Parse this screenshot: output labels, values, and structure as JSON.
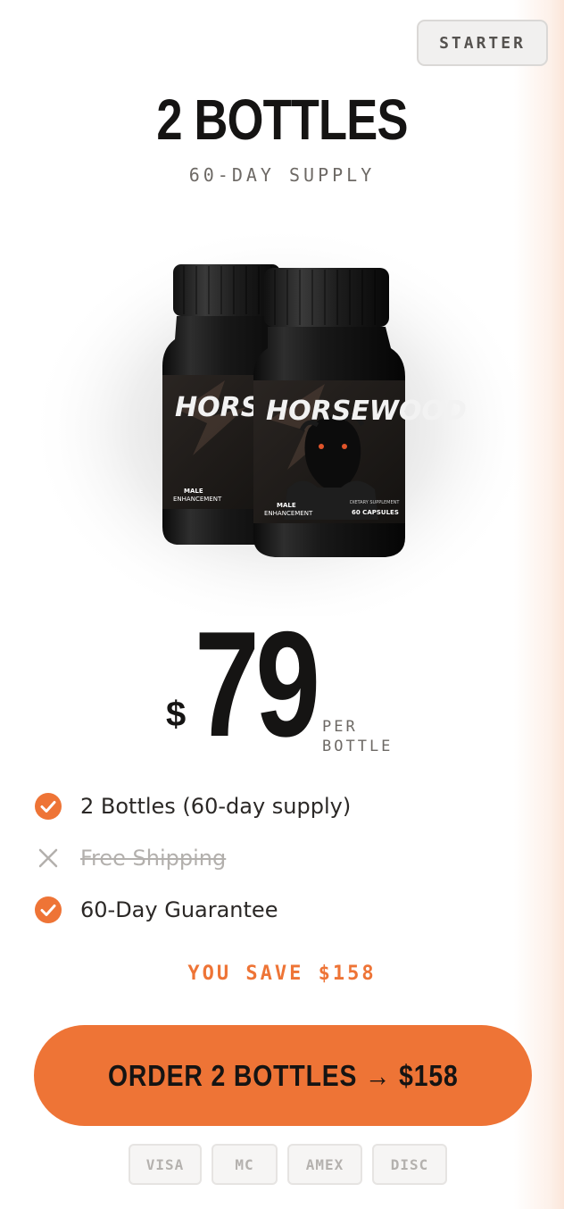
{
  "badge": {
    "label": "STARTER"
  },
  "title": "2 BOTTLES",
  "subtitle": "60-DAY SUPPLY",
  "product": {
    "bottle_brand": "HORSEWOOD",
    "label_line1": "MALE",
    "label_line2": "ENHANCEMENT",
    "label_supplement": "DIETARY SUPPLEMENT",
    "label_capsules": "60 CAPSULES"
  },
  "price": {
    "currency": "$",
    "amount": "79",
    "per_line1": "PER",
    "per_line2": "BOTTLE"
  },
  "features": [
    {
      "label": "2 Bottles (60-day supply)",
      "included": true,
      "icon": "check-circle-icon"
    },
    {
      "label": "Free Shipping",
      "included": false,
      "icon": "x-mark-icon"
    },
    {
      "label": "60-Day Guarantee",
      "included": true,
      "icon": "check-circle-icon"
    }
  ],
  "savings": "YOU SAVE $158",
  "cta": {
    "label": "ORDER 2 BOTTLES → $158"
  },
  "payment_methods": [
    "VISA",
    "MC",
    "AMEX",
    "DISC"
  ],
  "colors": {
    "accent": "#ee7436",
    "text_dark": "#151413",
    "text_muted": "#6d6965",
    "disabled": "#b3b0ad"
  }
}
